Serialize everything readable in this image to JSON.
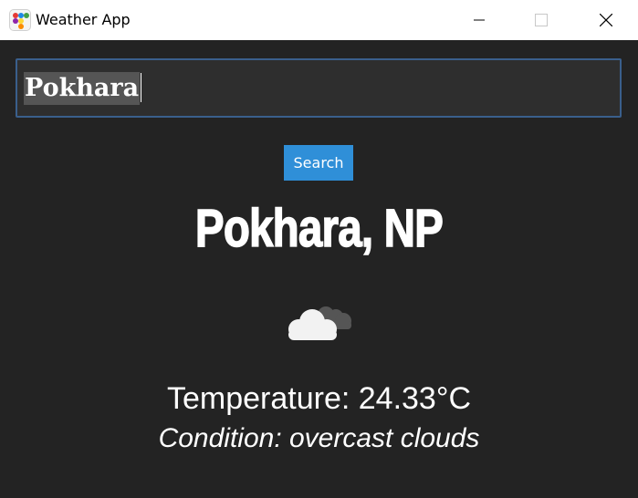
{
  "window": {
    "title": "Weather App",
    "app_icon": "app-dots-icon",
    "controls": {
      "minimize_icon": "minimize-icon",
      "maximize_icon": "maximize-icon",
      "close_icon": "close-icon"
    }
  },
  "search": {
    "value": "Pokhara"
  },
  "search_button": {
    "label": "Search"
  },
  "result": {
    "city": "Pokhara, NP",
    "weather_icon": "overcast-clouds-icon",
    "temperature": "Temperature: 24.33°C",
    "condition": "Condition: overcast clouds"
  },
  "colors": {
    "background": "#232323",
    "accent": "#2f8fd8",
    "input_border": "#3a5f8c",
    "titlebar": "#ffffff"
  }
}
